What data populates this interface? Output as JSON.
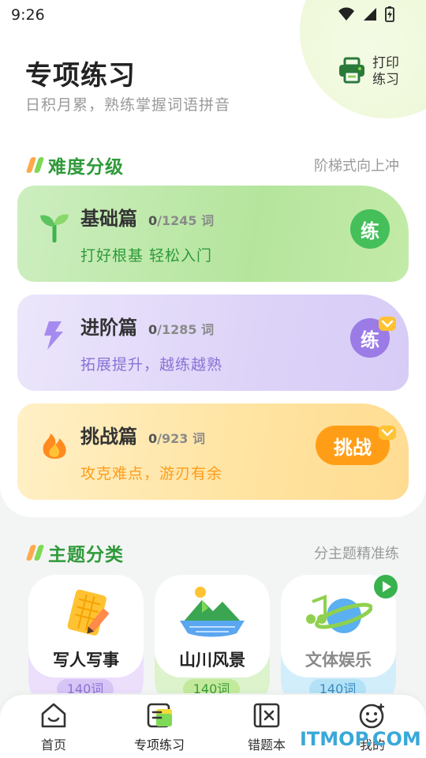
{
  "status_bar": {
    "time": "9:26"
  },
  "header": {
    "title": "专项练习",
    "subtitle": "日积月累，熟练掌握词语拼音",
    "print_label": "打印\n练习"
  },
  "difficulty": {
    "title": "难度分级",
    "right_text": "阶梯式向上冲",
    "levels": [
      {
        "name": "基础篇",
        "done": "0",
        "total": "/1245 词",
        "desc": "打好根基 轻松入门",
        "button": "练",
        "locked": false
      },
      {
        "name": "进阶篇",
        "done": "0",
        "total": "/1285 词",
        "desc": "拓展提升，越练越熟",
        "button": "练",
        "locked": true
      },
      {
        "name": "挑战篇",
        "done": "0",
        "total": "/923 词",
        "desc": "攻克难点，游刃有余",
        "button": "挑战",
        "locked": true
      }
    ]
  },
  "topics": {
    "title": "主题分类",
    "right_text": "分主题精准练",
    "items": [
      {
        "name": "写人写事",
        "count": "140词"
      },
      {
        "name": "山川风景",
        "count": "140词"
      },
      {
        "name": "文体娱乐",
        "count": "140词"
      }
    ]
  },
  "tab_bar": {
    "items": [
      {
        "label": "首页",
        "icon": "home-icon",
        "active": false
      },
      {
        "label": "专项练习",
        "icon": "practice-icon",
        "active": true
      },
      {
        "label": "错题本",
        "icon": "mistake-book-icon",
        "active": false
      },
      {
        "label": "我的",
        "icon": "profile-icon",
        "active": false
      }
    ]
  },
  "watermark": "ITMOP.COM",
  "colors": {
    "accent_green": "#2f9a3a",
    "purple": "#9b7be6",
    "orange": "#ff9c1a",
    "gold": "#ffc233"
  }
}
